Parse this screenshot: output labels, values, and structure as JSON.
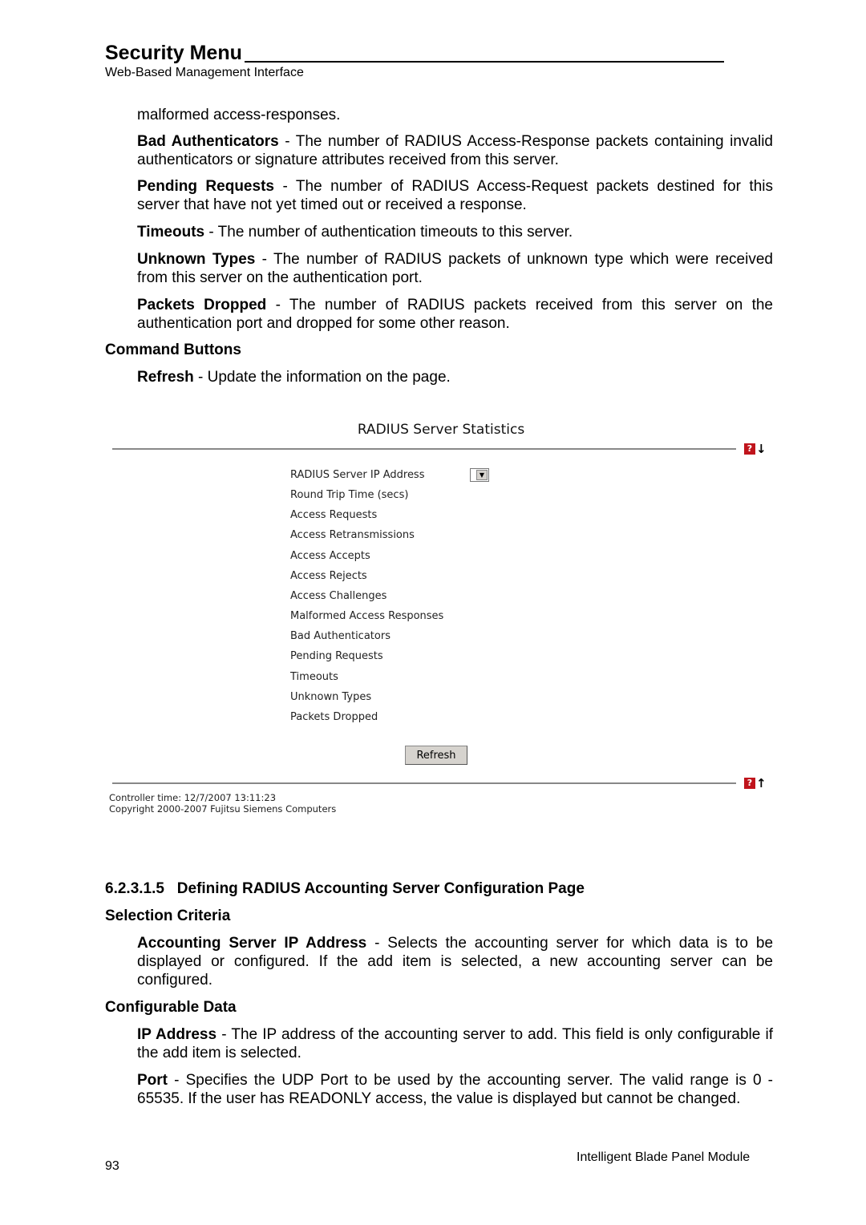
{
  "header": {
    "title": "Security Menu",
    "subtitle": "Web-Based Management Interface"
  },
  "body": {
    "intro": "malformed access-responses.",
    "definitions": [
      {
        "term": "Bad Authenticators",
        "text": " - The number of RADIUS Access-Response packets containing invalid authenticators or signature attributes received from this server."
      },
      {
        "term": "Pending Requests",
        "text": " - The number of RADIUS Access-Request packets destined for this server that have not yet timed out or received a response."
      },
      {
        "term": "Timeouts",
        "text": " - The number of authentication timeouts to this server."
      },
      {
        "term": "Unknown Types",
        "text": " - The number of RADIUS packets of unknown type which were received from this server on the authentication port."
      },
      {
        "term": "Packets Dropped",
        "text": " - The number of RADIUS packets received from this server on the authentication port and dropped for some other reason."
      }
    ],
    "command_heading": "Command Buttons",
    "refresh_def": {
      "term": "Refresh",
      "text": " - Update the information on the page."
    }
  },
  "screenshot": {
    "title": "RADIUS Server Statistics",
    "fields": [
      "RADIUS Server IP Address",
      "Round Trip Time (secs)",
      "Access Requests",
      "Access Retransmissions",
      "Access Accepts",
      "Access Rejects",
      "Access Challenges",
      "Malformed Access Responses",
      "Bad Authenticators",
      "Pending Requests",
      "Timeouts",
      "Unknown Types",
      "Packets Dropped"
    ],
    "refresh_label": "Refresh",
    "help_icon": "?",
    "controller_time": "Controller time: 12/7/2007 13:11:23",
    "copyright": "Copyright 2000-2007 Fujitsu Siemens Computers"
  },
  "section2": {
    "heading": "6.2.3.1.5   Defining RADIUS Accounting Server Configuration Page",
    "selection_heading": "Selection Criteria",
    "selection_def": {
      "term": "Accounting Server IP Address",
      "text": " - Selects the accounting server for which data is to be displayed or configured. If the add item is selected, a new accounting server can be configured."
    },
    "config_heading": "Configurable Data",
    "config_defs": [
      {
        "term": "IP Address",
        "text": " - The IP address of the accounting server to add. This field is only configurable if the add item is selected."
      },
      {
        "term": "Port",
        "text": " - Specifies the UDP Port to be used by the accounting server. The valid range is 0 - 65535. If the user has READONLY access, the value is displayed but cannot be changed."
      }
    ]
  },
  "footer": {
    "page_number": "93",
    "product": "Intelligent Blade Panel Module"
  }
}
